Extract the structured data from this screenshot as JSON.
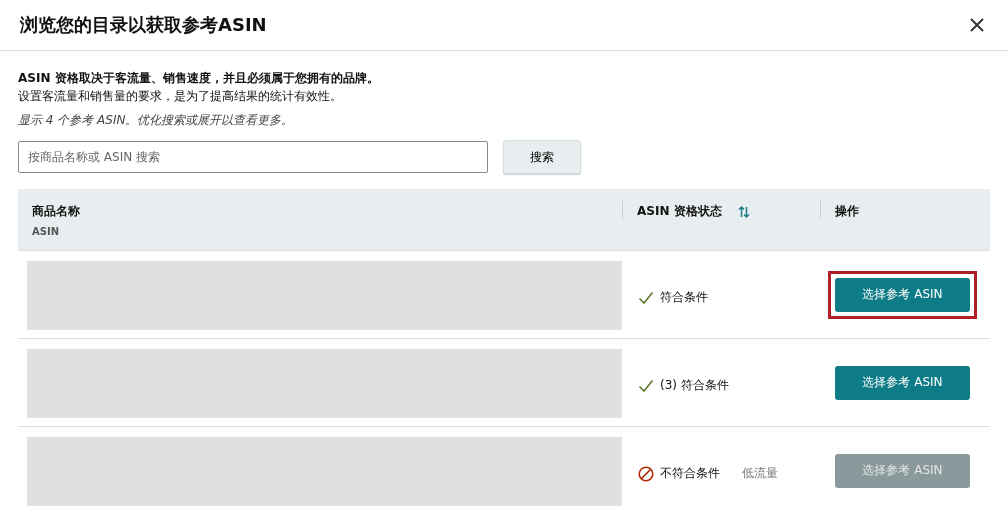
{
  "dialog": {
    "title": "浏览您的目录以获取参考ASIN",
    "intro_bold": "ASIN 资格取决于客流量、销售速度，并且必须属于您拥有的品牌。",
    "intro": "设置客流量和销售量的要求，是为了提高结果的统计有效性。",
    "note": "显示 4 个参考 ASIN。优化搜索或展开以查看更多。"
  },
  "search": {
    "placeholder": "按商品名称或 ASIN 搜索",
    "button": "搜索"
  },
  "table": {
    "columns": [
      {
        "label": "商品名称",
        "sub": "ASIN",
        "sortable": false
      },
      {
        "label": "ASIN 资格状态",
        "sortable": true
      },
      {
        "label": "操作",
        "sortable": false
      }
    ],
    "rows": [
      {
        "kind": "eligible",
        "status": "符合条件",
        "action": "选择参考 ASIN",
        "disabled": false,
        "highlighted": true
      },
      {
        "kind": "eligible",
        "status": "(3) 符合条件",
        "action": "选择参考 ASIN",
        "disabled": false,
        "highlighted": false
      },
      {
        "kind": "ineligible",
        "status": "不符合条件",
        "reason": "低流量",
        "action": "选择参考 ASIN",
        "disabled": true,
        "highlighted": false
      }
    ]
  }
}
